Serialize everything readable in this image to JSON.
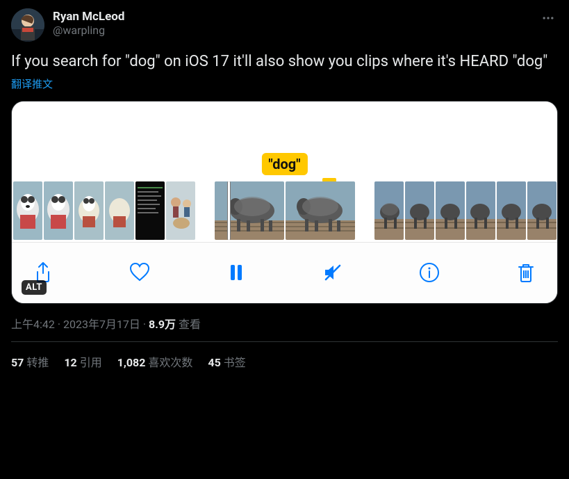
{
  "author": {
    "display_name": "Ryan McLeod",
    "handle": "@warpling"
  },
  "tweet_text": "If you search for \"dog\" on iOS 17 it'll also show you clips where it's HEARD \"dog\"",
  "translate_label": "翻译推文",
  "media": {
    "search_term_label": "\"dog\"",
    "alt_badge": "ALT",
    "toolbar_icons": [
      "share",
      "like",
      "pause",
      "mute",
      "info",
      "trash"
    ]
  },
  "timestamp": "上午4:42 · 2023年7月17日",
  "views_count": "8.9万",
  "views_label": "查看",
  "stats": {
    "retweets_count": "57",
    "retweets_label": "转推",
    "quotes_count": "12",
    "quotes_label": "引用",
    "likes_count": "1,082",
    "likes_label": "喜欢次数",
    "bookmarks_count": "45",
    "bookmarks_label": "书签"
  }
}
